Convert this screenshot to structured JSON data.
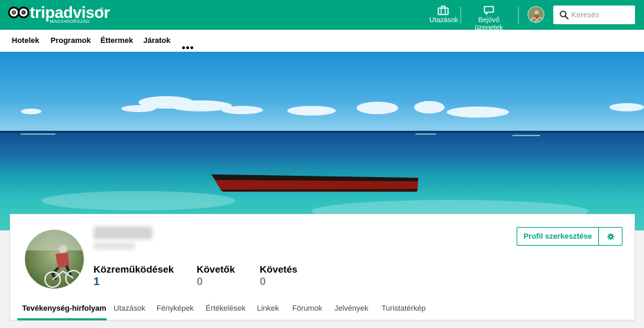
{
  "header": {
    "brand": "tripadvisor",
    "brand_sub": "MAGYARORSZÁG",
    "brand_mark": "®",
    "trips_label": "Utazások",
    "inbox_label": "Bejövő üzenetek",
    "search_placeholder": "Keresés",
    "icons": {
      "trips": "suitcase-icon",
      "inbox": "speech-bubble-icon",
      "search": "magnifier-icon"
    }
  },
  "nav": {
    "items": [
      "Hotelek",
      "Programok",
      "Éttermek",
      "Járatok"
    ],
    "more": "more-dots-icon"
  },
  "profile": {
    "stats": [
      {
        "label": "Közreműködések",
        "value": "1"
      },
      {
        "label": "Követők",
        "value": "0"
      },
      {
        "label": "Követés",
        "value": "0"
      }
    ],
    "edit_label": "Profil szerkesztése",
    "settings_icon": "gear-icon"
  },
  "tabs": {
    "items": [
      "Tevékenység-hírfolyam",
      "Utazások",
      "Fényképek",
      "Értékelések",
      "Linkek",
      "Fórumok",
      "Jelvények",
      "Turistatérkép"
    ],
    "active": "Tevékenység-hírfolyam"
  },
  "colors": {
    "brand": "#00a680",
    "contrib_value": "#1f4e7a",
    "muted_value": "#8a8a8a"
  }
}
